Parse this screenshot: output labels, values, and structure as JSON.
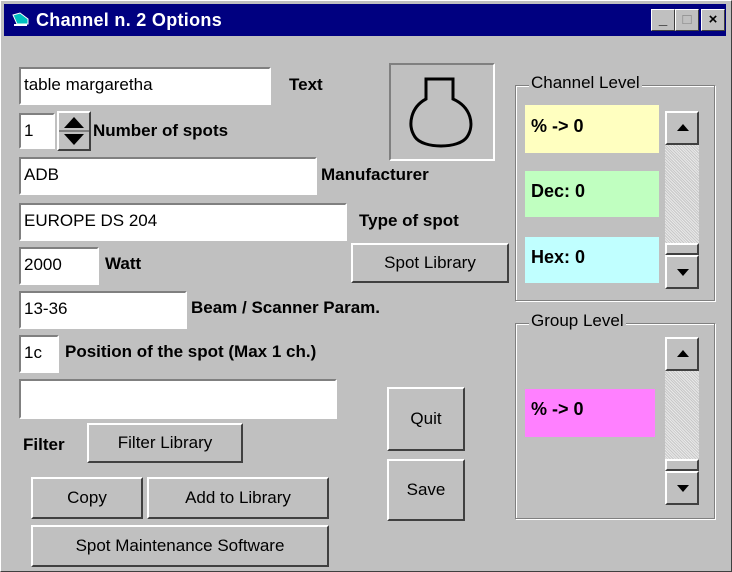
{
  "window": {
    "title": "Channel n. 2 Options",
    "min_glyph": "_",
    "max_glyph": "□",
    "close_glyph": "×"
  },
  "form": {
    "text_value": "table margaretha",
    "text_label": "Text",
    "spots_value": "1",
    "spots_label": "Number of spots",
    "manufacturer_value": "ADB",
    "manufacturer_label": "Manufacturer",
    "type_value": "EUROPE DS 204",
    "type_label": "Type of spot",
    "watt_value": "2000",
    "watt_label": "Watt",
    "spot_library": "Spot Library",
    "beam_value": "13-36",
    "beam_label": "Beam / Scanner Param.",
    "position_value": "1c",
    "position_label": "Position of the spot (Max 1 ch.)",
    "filter_value": "",
    "filter_label": "Filter",
    "filter_library": "Filter Library"
  },
  "buttons": {
    "quit": "Quit",
    "save": "Save",
    "copy": "Copy",
    "add_to_library": "Add to Library",
    "spot_maintenance": "Spot Maintenance Software"
  },
  "channel_level": {
    "label": "Channel Level",
    "percent": "% -> 0",
    "dec": "Dec: 0",
    "hex": "Hex: 0",
    "colors": {
      "percent": "#ffffc0",
      "dec": "#c0ffc0",
      "hex": "#c0ffff"
    }
  },
  "group_level": {
    "label": "Group Level",
    "percent": "% -> 0",
    "colors": {
      "percent": "#ff80ff"
    }
  },
  "icons": {
    "spot_preview": "spotlight-outline-icon"
  },
  "accent": {
    "titlebar": "#000080"
  }
}
